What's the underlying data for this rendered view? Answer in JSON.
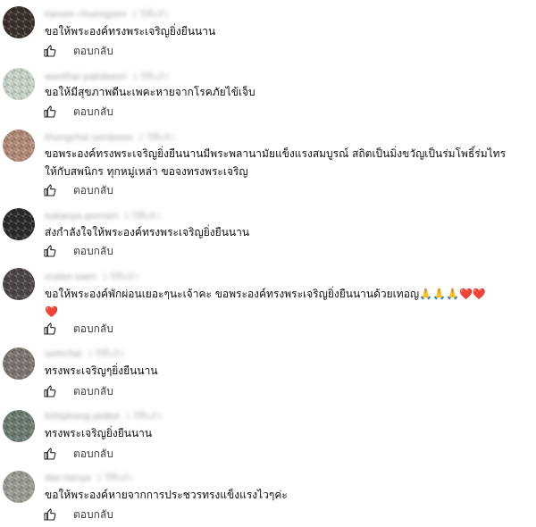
{
  "comments": [
    {
      "author": "kanom chuengsen",
      "time": "1 ปีที่แล้ว",
      "text": "ขอให้พระองค์ทรงพระเจริญยิ่งยืนนาน",
      "reply_label": "ตอบกลับ",
      "avatar_color": "#3a2e2a"
    },
    {
      "author": "wanthai pakdeesri",
      "time": "1 ปีที่แล้ว",
      "text": "ขอให้มีสุขภาพดีนะเพคะหายจากโรคภัยไข้เจ็บ",
      "reply_label": "ตอบกลับ",
      "avatar_color": "#c7d2c6"
    },
    {
      "author": "thongchai somboon",
      "time": "1 ปีที่แล้ว",
      "text": "ขอพระองค์ทรงพระเจริญยิ่งยืนนานมีพระพลานามัยแข็งแรงสมบูรณ์ สถิตเป็นมิ่งขวัญเป็นร่มโพธิ์ร่มไทรให้กับสพนิกร ทุกหมู่เหล่า ขอจงทรงพระเจริญ",
      "reply_label": "ตอบกลับ",
      "avatar_color": "#b08878"
    },
    {
      "author": "sukanya pornsiri",
      "time": "1 ปีที่แล้ว",
      "text": "ส่งกำลังใจให้พระองค์ทรงพระเจริญยิ่งยืนนาน",
      "reply_label": "ตอบกลับ",
      "avatar_color": "#2a2a2a"
    },
    {
      "author": "malee saen",
      "time": "1 ปีที่แล้ว",
      "text": "ขอให้พระองค์พักผ่อนเยอะๆนะเจ้าคะ ขอพระองค์ทรงพระเจริญยิ่งยืนนานด้วยเทอญ🙏🙏🙏",
      "hearts": "❤️❤️",
      "extra_heart": "❤️",
      "reply_label": "ตอบกลับ",
      "avatar_color": "#4a4448"
    },
    {
      "author": "somchai",
      "time": "1 ปีที่แล้ว",
      "text": "ทรงพระเจริญๆยิ่งยืนนาน",
      "reply_label": "ตอบกลับ",
      "avatar_color": "#7c7470"
    },
    {
      "author": "kittiphong jaidee",
      "time": "1 ปีที่แล้ว",
      "text": "ทรงพระเจริญยิ่งยืนนาน",
      "reply_label": "ตอบกลับ",
      "avatar_color": "#6a7a70"
    },
    {
      "author": "dao kanya",
      "time": "1 ปีที่แล้ว",
      "text": "ขอให้พระองค์หายจากการประชวรทรงแข็งแรงไวๆค่ะ",
      "reply_label": "ตอบกลับ",
      "avatar_color": "#9a9a92"
    }
  ]
}
